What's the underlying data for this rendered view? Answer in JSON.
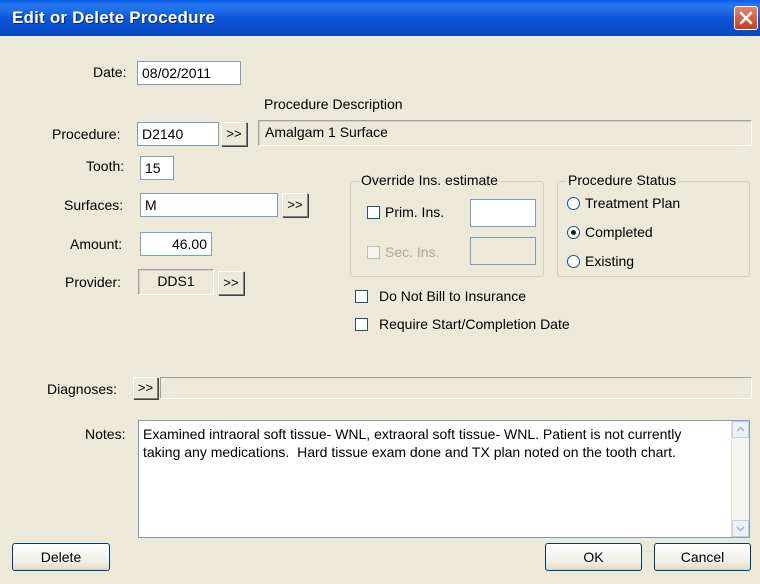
{
  "window": {
    "title": "Edit or Delete Procedure"
  },
  "date": {
    "label": "Date:",
    "value": "08/02/2011"
  },
  "procedure": {
    "label": "Procedure:",
    "code": "D2140",
    "picker_label": ">>",
    "description_heading": "Procedure Description",
    "description": "Amalgam 1 Surface"
  },
  "tooth": {
    "label": "Tooth:",
    "value": "15"
  },
  "surfaces": {
    "label": "Surfaces:",
    "value": "M",
    "picker_label": ">>"
  },
  "amount": {
    "label": "Amount:",
    "value": "46.00"
  },
  "provider": {
    "label": "Provider:",
    "value": "DDS1",
    "picker_label": ">>"
  },
  "override": {
    "legend": "Override Ins. estimate",
    "prim_label": "Prim. Ins.",
    "prim_checked": false,
    "prim_value": "",
    "sec_label": "Sec. Ins.",
    "sec_checked": false,
    "sec_value": ""
  },
  "status": {
    "legend": "Procedure Status",
    "options": [
      {
        "label": "Treatment Plan",
        "selected": false
      },
      {
        "label": "Completed",
        "selected": true
      },
      {
        "label": "Existing",
        "selected": false
      }
    ]
  },
  "options": {
    "do_not_bill": {
      "label": "Do Not Bill to Insurance",
      "checked": false
    },
    "require_dates": {
      "label": "Require Start/Completion Date",
      "checked": false
    }
  },
  "diagnoses": {
    "label": "Diagnoses:",
    "picker_label": ">>",
    "value": ""
  },
  "notes": {
    "label": "Notes:",
    "text": "Examined intraoral soft tissue- WNL, extraoral soft tissue- WNL. Patient is not currently taking any medications.  Hard tissue exam done and TX plan noted on the tooth chart."
  },
  "buttons": {
    "delete": "Delete",
    "ok": "OK",
    "cancel": "Cancel"
  },
  "colors": {
    "titlebar": "#0a54d6",
    "dialog_bg": "#ece9d8",
    "close_button": "#d0532e"
  }
}
